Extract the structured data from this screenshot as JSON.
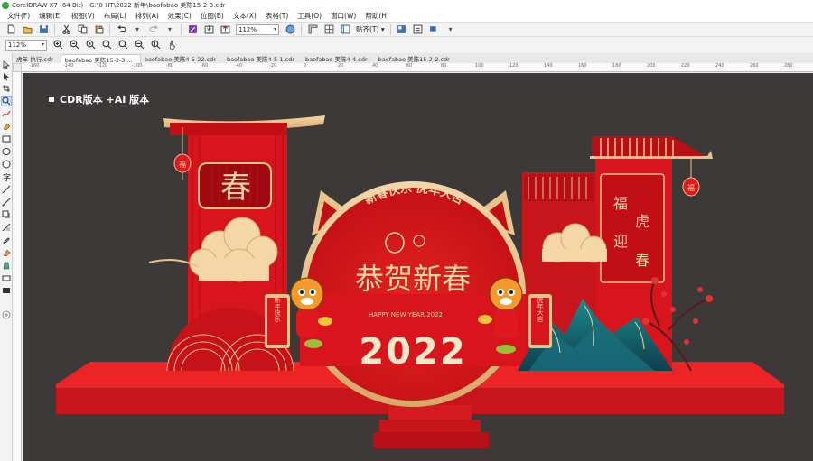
{
  "window": {
    "title": "CorelDRAW X7 (64-Bit) - G:\\0 HT\\2022 新年\\baofabao 美陈15-2-3.cdr"
  },
  "menu": [
    "文件(F)",
    "编辑(E)",
    "视图(V)",
    "布局(L)",
    "排列(A)",
    "效果(C)",
    "位图(B)",
    "文本(X)",
    "表格(T)",
    "工具(O)",
    "窗口(W)",
    "帮助(H)"
  ],
  "toolbar": {
    "zoom_value": "112%",
    "snap_label": "贴齐(T)"
  },
  "propbar": {
    "zoom_value": "112%"
  },
  "tabs": [
    {
      "label": "虎年-执行.cdr",
      "active": false
    },
    {
      "label": "baofabao 美陈15-2-3....",
      "active": true
    },
    {
      "label": "baofabao 美陈4-5-22.cdr",
      "active": false
    },
    {
      "label": "baofabao 美陈4-5-1.cdr",
      "active": false
    },
    {
      "label": "baofabao 美陈4-4.cdr",
      "active": false
    },
    {
      "label": "baofabao 美陈15-2-2.cdr",
      "active": false
    }
  ],
  "ruler": {
    "h_ticks": [
      "-160",
      "-140",
      "-120",
      "-100",
      "-80",
      "-60",
      "-40",
      "-20",
      "0",
      "20",
      "40",
      "60",
      "80",
      "100",
      "120",
      "140",
      "160",
      "180",
      "200",
      "220",
      "240",
      "260",
      "280"
    ]
  },
  "canvas": {
    "note": "CDR版本 +AI 版本",
    "bg": "#3d3939"
  },
  "artwork": {
    "left_panel_char": "春",
    "arch_top_text": "新春快乐 虎年大吉",
    "main_title": "恭贺新春",
    "sub_title": "HAPPY NEW YEAR 2022",
    "year": "2022",
    "right_panel_text": [
      "福",
      "虎",
      "迎",
      "春"
    ],
    "left_scroll_text": "新年快乐",
    "right_scroll_text": "虎年大吉",
    "lantern_char": "福",
    "colors": {
      "red": "#d8141c",
      "dark_red": "#b30d14",
      "gold": "#e8c38a",
      "deep_red": "#a50d12"
    }
  }
}
